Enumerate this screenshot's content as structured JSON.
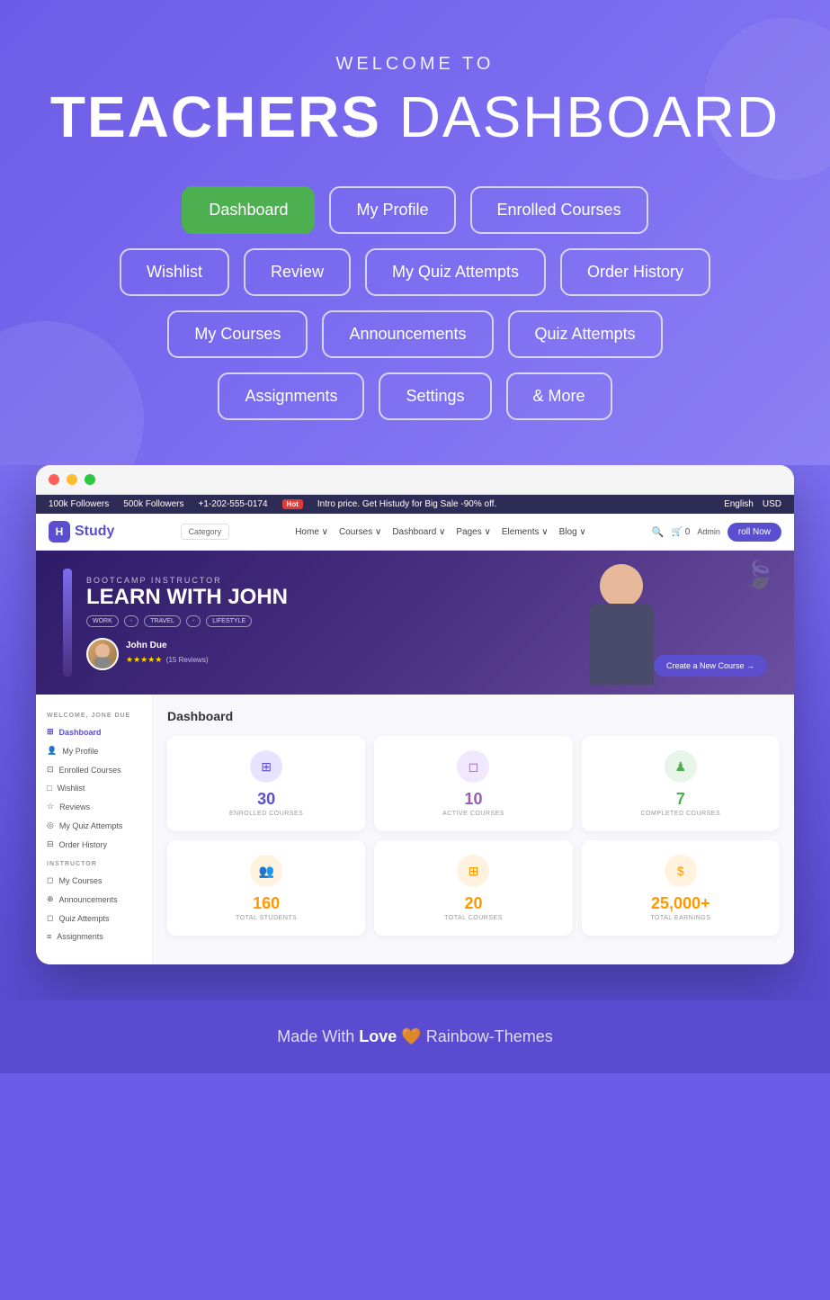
{
  "hero": {
    "welcome": "WELCOME TO",
    "title_bold": "TEACHERS",
    "title_regular": " DASHBOARD"
  },
  "nav_buttons": {
    "row1": [
      {
        "label": "Dashboard",
        "active": true
      },
      {
        "label": "My Profile",
        "active": false
      },
      {
        "label": "Enrolled Courses",
        "active": false
      }
    ],
    "row2": [
      {
        "label": "Wishlist",
        "active": false
      },
      {
        "label": "Review",
        "active": false
      },
      {
        "label": "My Quiz Attempts",
        "active": false
      },
      {
        "label": "Order History",
        "active": false
      }
    ],
    "row3": [
      {
        "label": "My Courses",
        "active": false
      },
      {
        "label": "Announcements",
        "active": false
      },
      {
        "label": "Quiz Attempts",
        "active": false
      }
    ],
    "row4": [
      {
        "label": "Assignments",
        "active": false
      },
      {
        "label": "Settings",
        "active": false
      },
      {
        "label": "& More",
        "active": false
      }
    ]
  },
  "browser": {
    "top_bar": {
      "followers1": "100k Followers",
      "followers2": "500k Followers",
      "phone": "+1-202-555-0174",
      "hot": "Hot",
      "promo": "Intro price. Get Histudy for Big Sale -90% off.",
      "lang": "English",
      "currency": "USD"
    },
    "nav_bar": {
      "logo": "Study",
      "logo_prefix": "H",
      "category": "Category",
      "links": [
        "Home",
        "Courses",
        "Dashboard",
        "Pages",
        "Elements",
        "Blog"
      ],
      "search": "🔍",
      "cart": "🛒",
      "admin": "Admin",
      "enroll": "roll Now"
    },
    "site_hero": {
      "bootcamp_label": "BOOTCAMP INSTRUCTOR",
      "title": "LEARN WITH JOHN",
      "tags": [
        "WORK",
        "TRAVEL",
        "LIFESTYLE"
      ],
      "instructor_name": "John Due",
      "rating": "★★★★★",
      "reviews": "(15 Reviews)",
      "create_btn": "Create a New Course →"
    },
    "sidebar": {
      "welcome": "WELCOME, JONE DUE",
      "student_items": [
        {
          "icon": "⊞",
          "label": "Dashboard",
          "active": true
        },
        {
          "icon": "👤",
          "label": "My Profile",
          "active": false
        },
        {
          "icon": "⊡",
          "label": "Enrolled Courses",
          "active": false
        },
        {
          "icon": "□",
          "label": "Wishlist",
          "active": false
        },
        {
          "icon": "☆",
          "label": "Reviews",
          "active": false
        },
        {
          "icon": "◎",
          "label": "My Quiz Attempts",
          "active": false
        },
        {
          "icon": "⊟",
          "label": "Order History",
          "active": false
        }
      ],
      "instructor_label": "INSTRUCTOR",
      "instructor_items": [
        {
          "icon": "◻",
          "label": "My Courses",
          "active": false
        },
        {
          "icon": "⊕",
          "label": "Announcements",
          "active": false
        },
        {
          "icon": "◻",
          "label": "Quiz Attempts",
          "active": false
        },
        {
          "icon": "≡",
          "label": "Assignments",
          "active": false
        }
      ]
    },
    "dashboard": {
      "title": "Dashboard",
      "stats_row1": [
        {
          "icon": "⊞",
          "icon_class": "blue",
          "number": "30",
          "number_class": "blue",
          "label": "ENROLLED COURSES"
        },
        {
          "icon": "◻",
          "icon_class": "purple",
          "number": "10",
          "number_class": "purple",
          "label": "ACTIVE COURSES"
        },
        {
          "icon": "♟",
          "icon_class": "green",
          "number": "7",
          "number_class": "green",
          "label": "COMPLETED COURSES"
        }
      ],
      "stats_row2": [
        {
          "icon": "👥",
          "icon_class": "orange",
          "number": "160",
          "number_class": "orange",
          "label": "TOTAL STUDENTS"
        },
        {
          "icon": "⊞",
          "icon_class": "orange",
          "number": "20",
          "number_class": "orange",
          "label": "TOTAL COURSES"
        },
        {
          "icon": "$",
          "icon_class": "orange",
          "number": "25,000+",
          "number_class": "orange",
          "label": "TOTAL EARNINGS"
        }
      ]
    }
  },
  "footer": {
    "text_before": "Made With",
    "bold": "Love",
    "heart": "🧡",
    "text_after": "Rainbow-Themes"
  }
}
